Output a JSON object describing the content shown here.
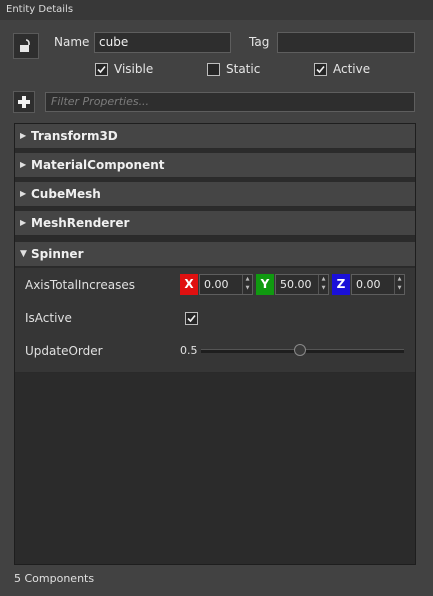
{
  "window": {
    "title": "Entity Details"
  },
  "entity": {
    "name_label": "Name",
    "name_value": "cube",
    "tag_label": "Tag",
    "tag_value": "",
    "visible_label": "Visible",
    "visible_checked": true,
    "static_label": "Static",
    "static_checked": false,
    "active_label": "Active",
    "active_checked": true
  },
  "filter": {
    "placeholder": "Filter Properties..."
  },
  "components": [
    {
      "name": "Transform3D",
      "expanded": false
    },
    {
      "name": "MaterialComponent",
      "expanded": false
    },
    {
      "name": "CubeMesh",
      "expanded": false
    },
    {
      "name": "MeshRenderer",
      "expanded": false
    },
    {
      "name": "Spinner",
      "expanded": true
    }
  ],
  "spinner": {
    "axis_label": "AxisTotalIncreases",
    "x_label": "X",
    "x_value": "0.00",
    "y_label": "Y",
    "y_value": "50.00",
    "z_label": "Z",
    "z_value": "0.00",
    "isactive_label": "IsActive",
    "isactive_checked": true,
    "updateorder_label": "UpdateOrder",
    "updateorder_value": "0.5",
    "updateorder_fraction": 0.5
  },
  "footer": {
    "count": "5 Components"
  },
  "colors": {
    "x_axis": "#e01010",
    "y_axis": "#109a10",
    "z_axis": "#1a10d8"
  },
  "icons": {
    "lock": "unlock-icon",
    "add": "plus-icon",
    "collapsed": "triangle-right",
    "expanded": "triangle-down"
  }
}
